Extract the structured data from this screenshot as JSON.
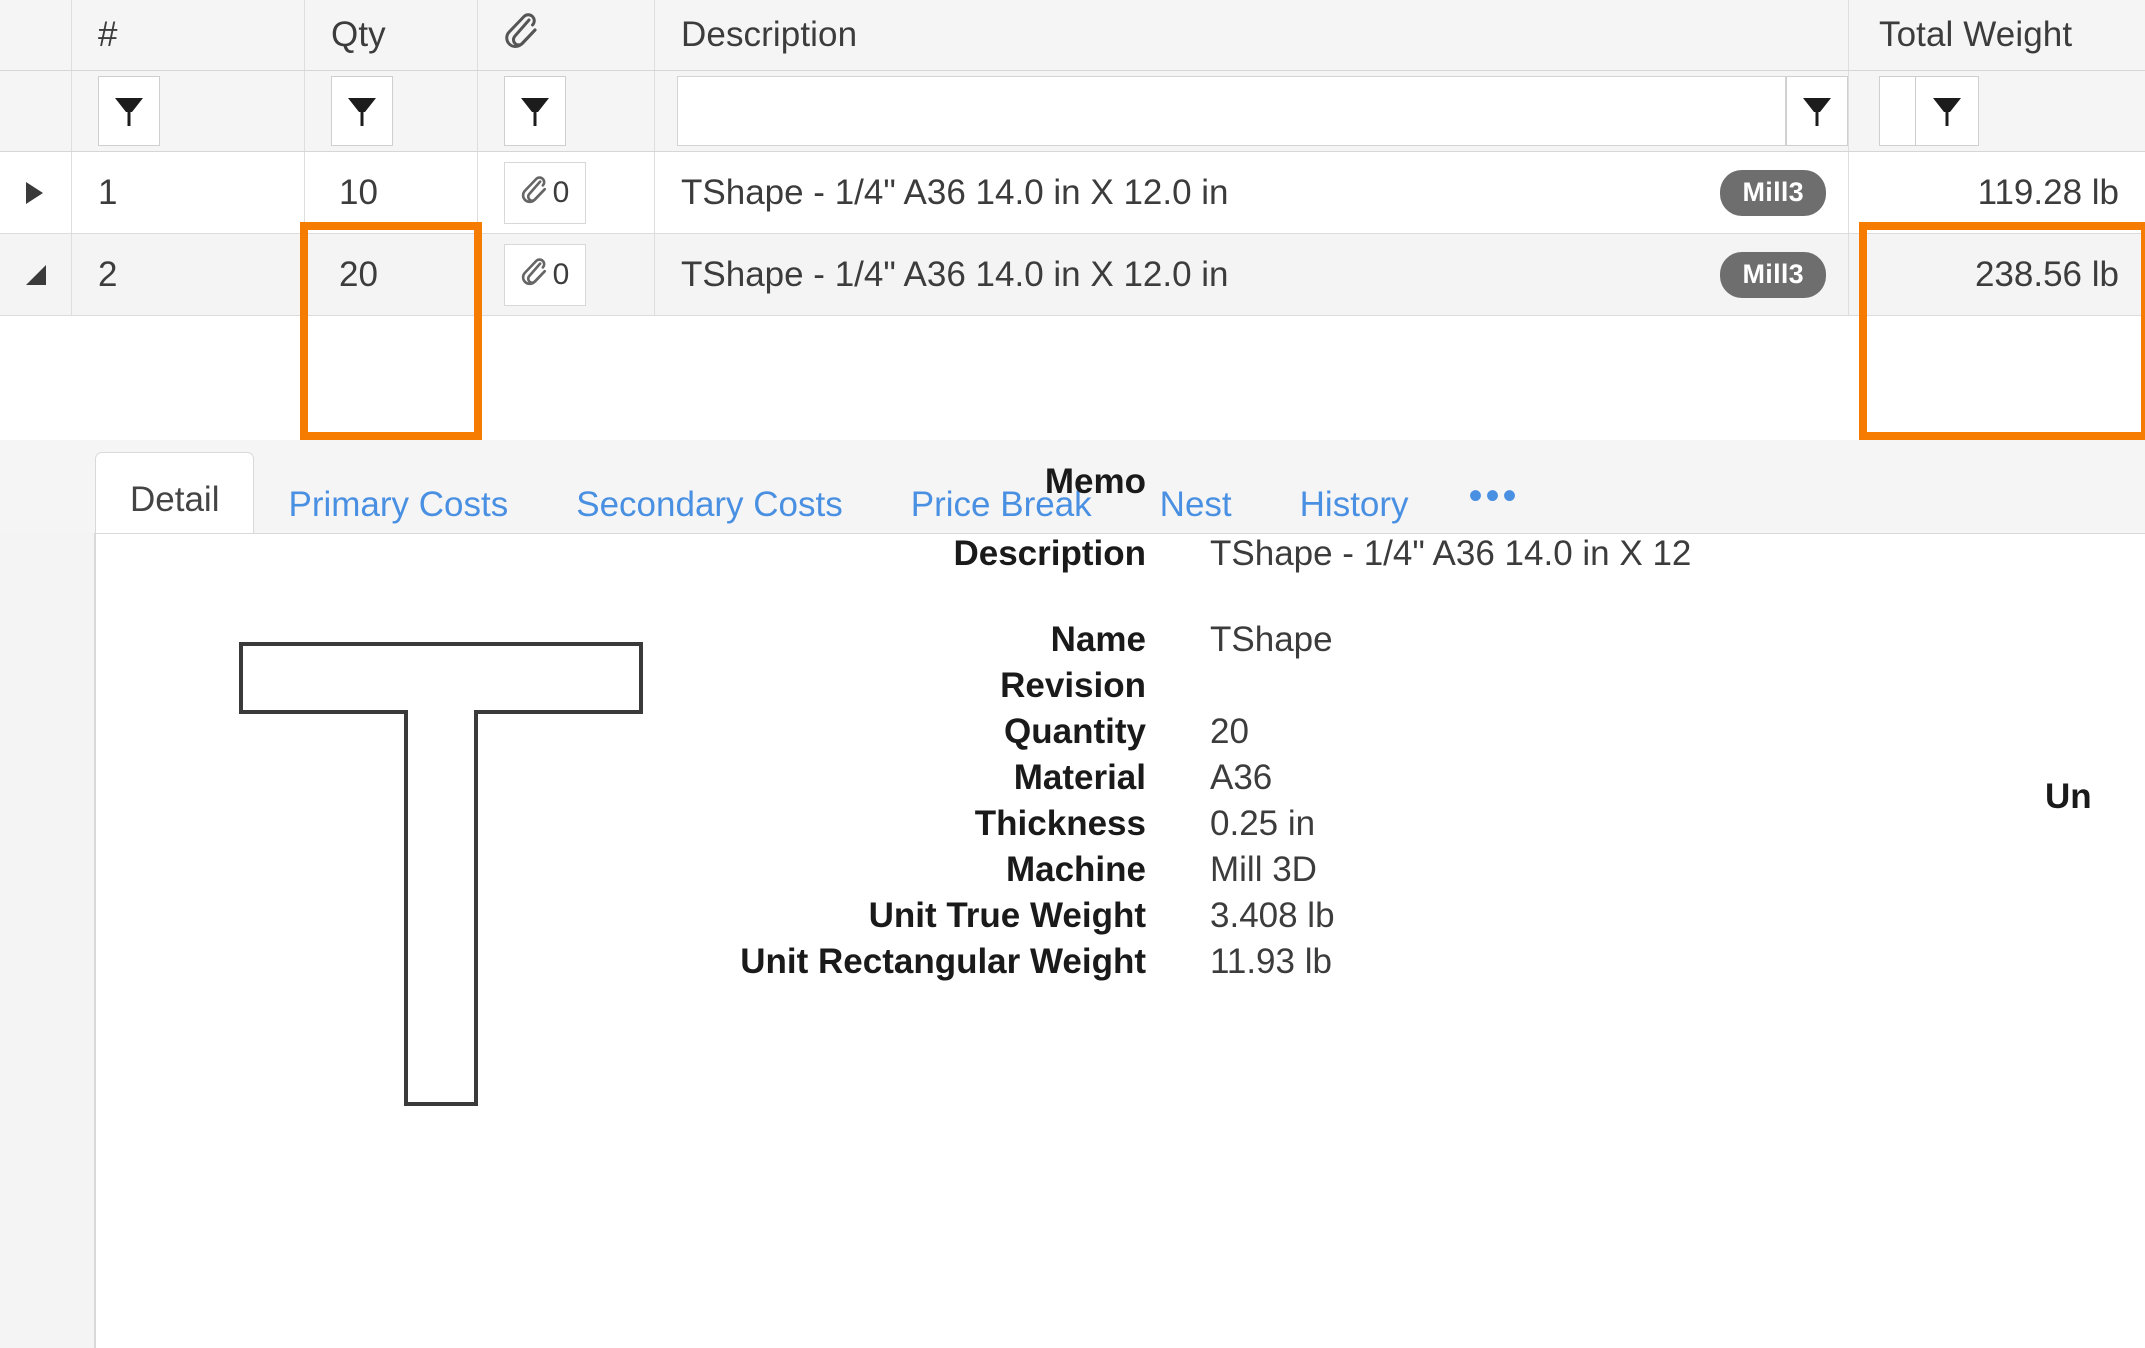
{
  "grid": {
    "columns": [
      {
        "key": "expander",
        "label": ""
      },
      {
        "key": "num",
        "label": "#"
      },
      {
        "key": "qty",
        "label": "Qty"
      },
      {
        "key": "attachments",
        "label": "",
        "icon": "paperclip-icon"
      },
      {
        "key": "description",
        "label": "Description"
      },
      {
        "key": "total_weight",
        "label": "Total Weight"
      }
    ],
    "filter_row": {
      "description_value": "",
      "description_placeholder": "",
      "total_weight_value": "",
      "filter_icon": "funnel-icon"
    },
    "rows": [
      {
        "num": "1",
        "qty": "10",
        "attachment_count": "0",
        "description": "TShape - 1/4\" A36 14.0 in X 12.0 in",
        "badge": "Mill3",
        "total_weight": "119.28 lb",
        "expander_state": "collapsed"
      },
      {
        "num": "2",
        "qty": "20",
        "attachment_count": "0",
        "description": "TShape - 1/4\" A36 14.0 in X 12.0 in",
        "badge": "Mill3",
        "total_weight": "238.56 lb",
        "expander_state": "expanded"
      }
    ],
    "highlight_color": "#f57c00"
  },
  "tabs": {
    "items": [
      {
        "label": "Detail",
        "active": true
      },
      {
        "label": "Primary Costs",
        "active": false
      },
      {
        "label": "Secondary Costs",
        "active": false
      },
      {
        "label": "Price Break",
        "active": false
      },
      {
        "label": "Nest",
        "active": false
      },
      {
        "label": "History",
        "active": false
      }
    ],
    "overflow_label": "•••"
  },
  "detail": {
    "shape_preview": "t-shape-outline",
    "fields": [
      {
        "label": "Memo",
        "value": ""
      },
      {
        "label": "Description",
        "value": "TShape - 1/4\" A36 14.0 in X 12"
      },
      {
        "label": "Name",
        "value": "TShape"
      },
      {
        "label": "Revision",
        "value": ""
      },
      {
        "label": "Quantity",
        "value": "20"
      },
      {
        "label": "Material",
        "value": "A36"
      },
      {
        "label": "Thickness",
        "value": "0.25 in"
      },
      {
        "label": "Machine",
        "value": "Mill 3D"
      },
      {
        "label": "Unit True Weight",
        "value": "3.408 lb"
      },
      {
        "label": "Unit Rectangular Weight",
        "value": "11.93 lb"
      }
    ],
    "clipped_right_label": "Un"
  }
}
